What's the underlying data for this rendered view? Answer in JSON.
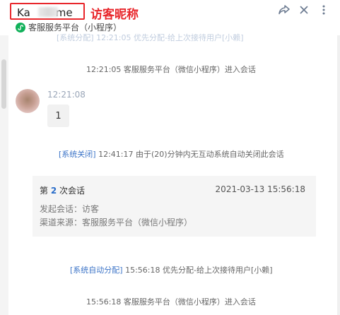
{
  "header": {
    "name_start": "Ka",
    "name_end": "me",
    "annotation": "访客昵称",
    "channel": "客服服务平台（小程序）"
  },
  "messages": {
    "cut_text": "[系统分配] 12:21:05 优先分配-给上次接待用户[小赖]",
    "sys1": "12:21:05 客服服务平台（微信小程序）进入会话",
    "msg_time": "12:21:08",
    "msg_body": "1",
    "sys2_tag": "[系统关闭]",
    "sys2_text": " 12:41:17 由于(20)分钟内无互动系统自动关闭此会话",
    "card": {
      "prefix": "第 ",
      "num": "2",
      "suffix": " 次会话",
      "date": "2021-03-13 15:56:18",
      "line1": "发起会话：访客",
      "line2": "渠道来源：客服服务平台（微信小程序）"
    },
    "sys3_tag": "[系统自动分配]",
    "sys3_text": " 15:56:18 优先分配-给上次接待用户[小赖]",
    "sys4": "15:56:18 客服服务平台（微信小程序）进入会话"
  },
  "colors": {
    "accent_red": "#e8262b",
    "link_blue": "#3c74c7",
    "wechat_green": "#11b15a"
  },
  "icons": [
    "share-icon",
    "close-icon",
    "more-icon",
    "wechat-miniprogram-icon"
  ]
}
